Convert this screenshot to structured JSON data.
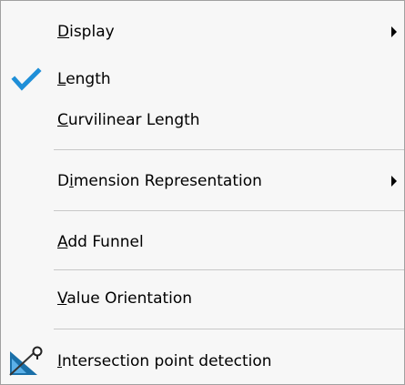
{
  "menu": {
    "items": [
      {
        "pre": "",
        "key": "D",
        "post": "isplay",
        "has_submenu": true
      },
      {
        "pre": "",
        "key": "L",
        "post": "ength",
        "checked": true
      },
      {
        "pre": "",
        "key": "C",
        "post": "urvilinear Length"
      },
      {
        "pre": "D",
        "key": "i",
        "post": "mension Representation",
        "has_submenu": true
      },
      {
        "pre": "",
        "key": "A",
        "post": "dd Funnel"
      },
      {
        "pre": "",
        "key": "V",
        "post": "alue Orientation"
      },
      {
        "pre": "",
        "key": "I",
        "post": "ntersection point detection",
        "icon": "intersection-point-icon"
      }
    ]
  },
  "colors": {
    "menu_bg": "#f7f7f7",
    "check_blue": "#1f8fd8",
    "separator": "#c8c8c8",
    "icon_triangle": "#1a6fa8"
  }
}
